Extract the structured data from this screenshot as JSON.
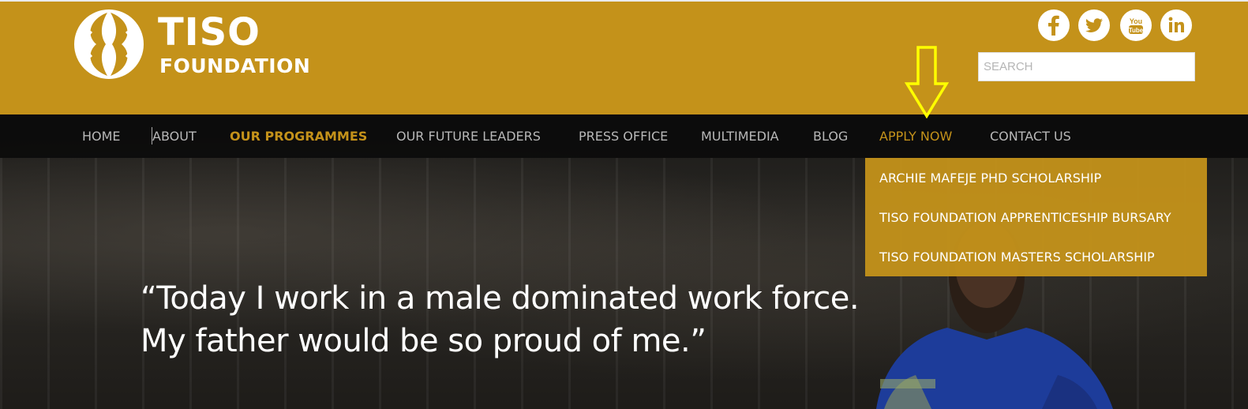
{
  "brand": {
    "name": "TISO",
    "subname": "FOUNDATION",
    "color": "#c4921a"
  },
  "social": [
    {
      "name": "facebook-icon",
      "glyph": "f"
    },
    {
      "name": "twitter-icon",
      "glyph": "twitter-bird"
    },
    {
      "name": "youtube-icon",
      "glyph": "You Tube"
    },
    {
      "name": "linkedin-icon",
      "glyph": "in"
    }
  ],
  "search": {
    "placeholder": "SEARCH",
    "value": ""
  },
  "nav": {
    "items": [
      {
        "label": "HOME"
      },
      {
        "label": "ABOUT"
      },
      {
        "label": "OUR PROGRAMMES"
      },
      {
        "label": "OUR FUTURE LEADERS"
      },
      {
        "label": "PRESS OFFICE"
      },
      {
        "label": "MULTIMEDIA"
      },
      {
        "label": "BLOG"
      },
      {
        "label": "APPLY NOW"
      },
      {
        "label": "CONTACT US"
      }
    ],
    "active_item": "OUR PROGRAMMES",
    "hover_item": "APPLY NOW"
  },
  "dropdown": {
    "items": [
      {
        "label": "ARCHIE MAFEJE PHD SCHOLARSHIP"
      },
      {
        "label": "TISO FOUNDATION APPRENTICESHIP BURSARY"
      },
      {
        "label": "TISO FOUNDATION MASTERS SCHOLARSHIP"
      }
    ]
  },
  "hero": {
    "quote_line1": "“Today I work in a male dominated work force.",
    "quote_line2": "My father would be so proud of me.”"
  },
  "annotation": {
    "arrow_color": "#ffff00",
    "icon": "down-arrow-icon"
  }
}
